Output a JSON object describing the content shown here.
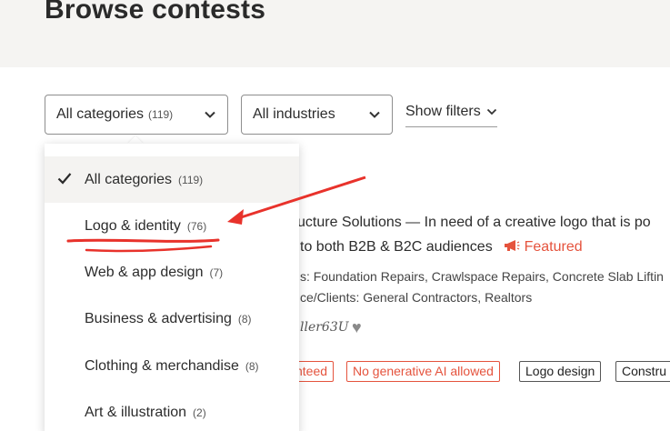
{
  "page": {
    "title": "Browse contests"
  },
  "filters": {
    "category": {
      "label": "All categories",
      "count": "(119)"
    },
    "industry": {
      "label": "All industries"
    },
    "show_filters": "Show filters"
  },
  "listing": {
    "title_fragment": "ucture Solutions — In need of a creative logo that is po",
    "subtitle_fragment": " to both B2B & B2C audiences",
    "featured_label": "Featured",
    "services_fragment": "s: Foundation Repairs, Crawlspace Repairs, Concrete Slab Liftin",
    "clients_fragment": "ce/Clients: General Contractors, Realtors",
    "holder_fragment": "ller63U",
    "tags": [
      "nteed",
      "No generative AI allowed",
      "Logo design",
      "Constru"
    ]
  },
  "dropdown": {
    "items": [
      {
        "label": "All categories",
        "count": "(119)",
        "selected": true
      },
      {
        "label": "Logo & identity",
        "count": "(76)",
        "selected": false
      },
      {
        "label": "Web & app design",
        "count": "(7)",
        "selected": false
      },
      {
        "label": "Business & advertising",
        "count": "(8)",
        "selected": false
      },
      {
        "label": "Clothing & merchandise",
        "count": "(8)",
        "selected": false
      },
      {
        "label": "Art & illustration",
        "count": "(2)",
        "selected": false
      }
    ]
  },
  "colors": {
    "accent_red": "#e5533d",
    "annotation_red": "#e8322b",
    "header_bg": "#f5f4f2"
  }
}
